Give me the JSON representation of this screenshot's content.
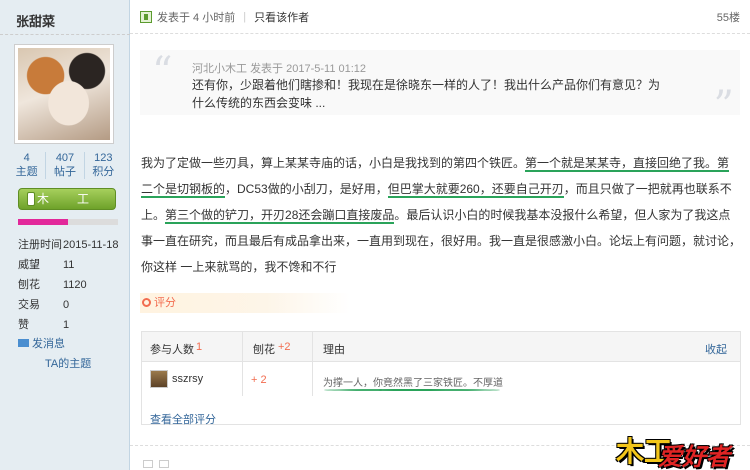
{
  "user": {
    "name": "张甜菜",
    "stats": [
      {
        "value": "4",
        "label": "主题"
      },
      {
        "value": "407",
        "label": "帖子"
      },
      {
        "value": "123",
        "label": "积分"
      }
    ],
    "rank_label": "木　工",
    "rank_progress": 0.5,
    "info": [
      {
        "key": "注册时间",
        "value": "2015-11-18"
      },
      {
        "key": "威望",
        "value": "11"
      },
      {
        "key": "刨花",
        "value": "1120"
      },
      {
        "key": "交易",
        "value": "0"
      },
      {
        "key": "赞",
        "value": "1"
      }
    ],
    "send_message": "发消息",
    "their_topics": "TA的主题"
  },
  "post": {
    "posted_at": "发表于 4 小时前",
    "author_only": "只看该作者",
    "floor": "55楼",
    "quote": {
      "author": "河北小木工",
      "time": "发表于 2017-5-11 01:12",
      "text": "还有你，少跟着他们瞎掺和！我现在是徐晓东一样的人了！我出什么产品你们有意见？为什么传统的东西会变味 ..."
    },
    "body": {
      "p1": "我为了定做一些刃具，算上某某寺庙的话，小白是我找到的第四个铁匠。",
      "u1": "第一个就是某某寺，直接回绝了我。",
      "u2": "第二个是切钢板的",
      "p2": "，DC53做的小刮刀，是好用，",
      "u3": "但巴掌大就要260，还要自己开刃",
      "p3": "，而且只做了一把就再也联系不上。",
      "u4": "第三个做的铲刀，开刃28还会蹦口直接废品",
      "p4": "。最后认识小白的时候我基本没报什么希望，但人家为了我这点事一直在研究，而且最后有成品拿出来，一直用到现在，很好用。我一直是很感激小白。论坛上有问题，就讨论，你这样  一上来就骂的，我不馋和不行"
    }
  },
  "rating": {
    "tab_label": "评分",
    "head": {
      "participants_label": "参与人数",
      "participants_count": "1",
      "score_label": "刨花",
      "score_value": "+2",
      "reason_label": "理由",
      "collapse": "收起"
    },
    "rows": [
      {
        "user": "sszrsy",
        "score": "+ 2",
        "reason": "为撑一人，你竟然黑了三家铁匠。不厚道"
      }
    ],
    "view_all": "查看全部评分"
  },
  "watermark": {
    "part1": "木工",
    "part2": "爱好者"
  },
  "colors": {
    "accent": "#336699",
    "underline": "#2aa35a",
    "rating": "#f26c4f",
    "rank_bar": "#e2289a"
  }
}
